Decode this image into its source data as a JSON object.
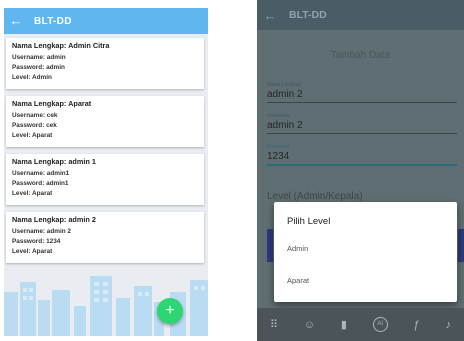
{
  "left_screen": {
    "app_title": "BLT-DD",
    "back_icon": "arrow-left-icon",
    "users": [
      {
        "name_line": "Nama Lengkap: Admin Citra",
        "username_line": "Username: admin",
        "password_line": "Password: admin",
        "level_line": "Level: Admin"
      },
      {
        "name_line": "Nama Lengkap: Aparat",
        "username_line": "Username: cek",
        "password_line": "Password: cek",
        "level_line": "Level: Aparat"
      },
      {
        "name_line": "Nama Lengkap: admin 1",
        "username_line": "Username: admin1",
        "password_line": "Password: admin1",
        "level_line": "Level: Aparat"
      },
      {
        "name_line": "Nama Lengkap: admin 2",
        "username_line": "Username: admin 2",
        "password_line": "Password: 1234",
        "level_line": "Level: Aparat"
      }
    ],
    "fab_icon": "plus-icon",
    "fab_label": "+",
    "accent_color": "#60b7f0",
    "fab_color": "#2ed573"
  },
  "right_screen": {
    "app_title": "BLT-DD",
    "back_icon": "arrow-left-icon",
    "form_title": "Tambah Data",
    "fields": {
      "nama_lengkap": {
        "label": "Nama Lengkap",
        "value": "admin 2"
      },
      "username": {
        "label": "Username",
        "value": "admin 2"
      },
      "password": {
        "label": "Password",
        "value": "1234"
      }
    },
    "level_label": "Level (Admin/Kepala)",
    "dialog": {
      "title": "Pilih Level",
      "options": [
        "Admin",
        "Aparat"
      ]
    },
    "overlay_color": "#5f6e72"
  }
}
